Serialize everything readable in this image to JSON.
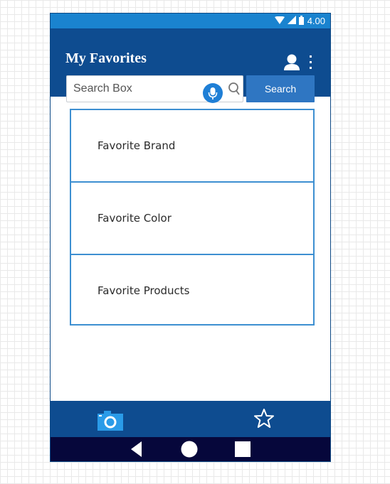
{
  "status_bar": {
    "time": "4.00",
    "icons": [
      "wifi-icon",
      "signal-icon",
      "battery-icon"
    ]
  },
  "header": {
    "title": "My Favorites",
    "icons": [
      "user-icon",
      "more-vert-icon"
    ]
  },
  "search": {
    "placeholder": "Search Box",
    "button_label": "Search",
    "icons": [
      "microphone-icon",
      "search-icon"
    ]
  },
  "favorites": {
    "items": [
      {
        "label": "Favorite Brand"
      },
      {
        "label": "Favorite Color"
      },
      {
        "label": "Favorite Products"
      }
    ]
  },
  "bottom_nav": {
    "items": [
      "camera-icon",
      "star-icon"
    ]
  },
  "system_nav": {
    "items": [
      "back-icon",
      "home-icon",
      "recents-icon"
    ]
  },
  "colors": {
    "app_bar": "#0e4c90",
    "status_bar": "#1a83cf",
    "button": "#2f76c2",
    "list_border": "#3d8fd1",
    "system_nav": "#06073b"
  }
}
